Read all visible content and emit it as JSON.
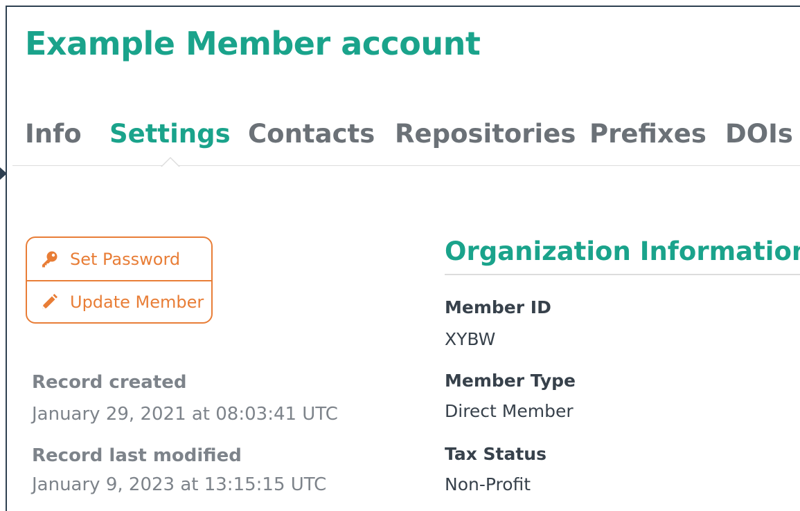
{
  "page": {
    "title": "Example Member account"
  },
  "tabs": [
    {
      "label": "Info",
      "active": false
    },
    {
      "label": "Settings",
      "active": true
    },
    {
      "label": "Contacts",
      "active": false
    },
    {
      "label": "Repositories",
      "active": false
    },
    {
      "label": "Prefixes",
      "active": false
    },
    {
      "label": "DOIs",
      "active": false
    }
  ],
  "actions": {
    "set_password": {
      "label": "Set Password",
      "icon": "key-icon"
    },
    "update_member": {
      "label": "Update Member",
      "icon": "pencil-icon"
    }
  },
  "record": {
    "created_label": "Record created",
    "created_value": "January 29, 2021 at 08:03:41 UTC",
    "modified_label": "Record last modified",
    "modified_value": "January 9, 2023 at 13:15:15 UTC"
  },
  "organization": {
    "title": "Organization Information",
    "fields": [
      {
        "label": "Member ID",
        "value": "XYBW"
      },
      {
        "label": "Member Type",
        "value": "Direct Member"
      },
      {
        "label": "Tax Status",
        "value": "Non-Profit"
      }
    ]
  },
  "colors": {
    "brand": "#1aa38b",
    "action": "#e87d36",
    "tab_inactive": "#6b7177",
    "meta_text": "#7d838a",
    "body_text": "#37414b"
  }
}
